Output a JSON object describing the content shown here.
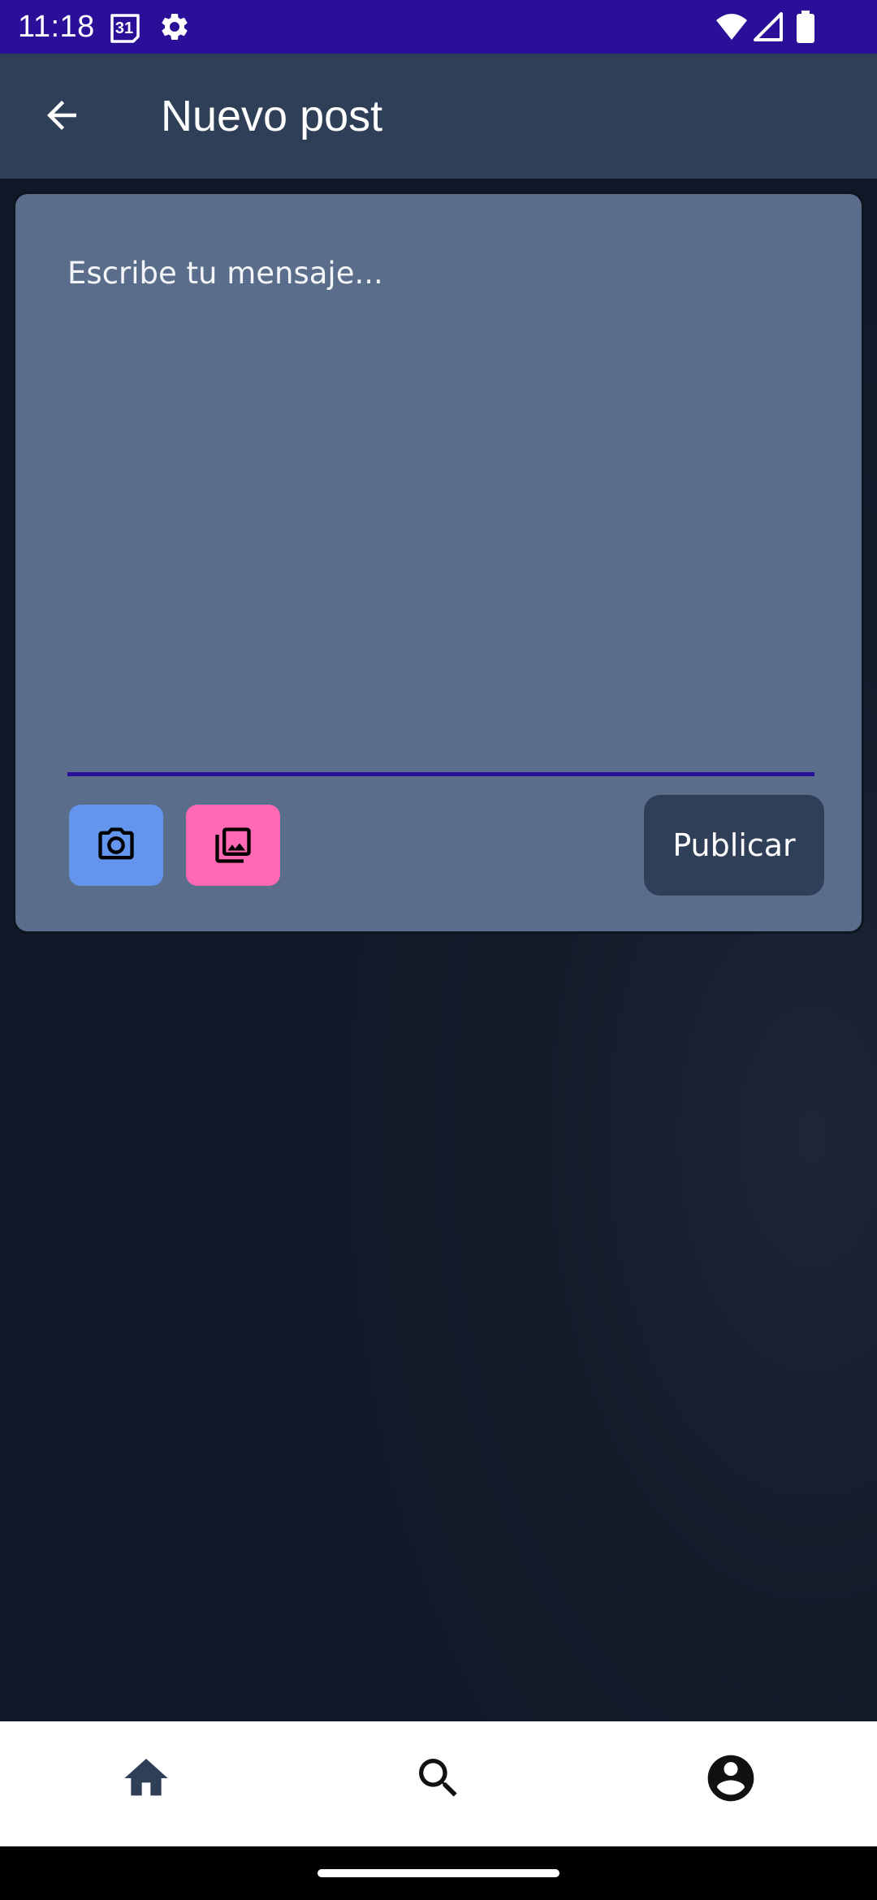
{
  "status_bar": {
    "time": "11:18",
    "calendar_badge": "31",
    "icons": [
      "calendar-icon",
      "settings-icon",
      "wifi-icon",
      "signal-icon",
      "battery-icon"
    ],
    "background_color": "#2a0f98"
  },
  "app_bar": {
    "back_icon": "arrow-back-icon",
    "title": "Nuevo post",
    "background_color": "#2f3f57"
  },
  "composer": {
    "message_placeholder": "Escribe tu mensaje...",
    "message_value": "",
    "underline_color": "#2a0f98",
    "card_color": "#5a6e8b",
    "camera_button": {
      "icon": "camera-icon",
      "color": "#6495ed"
    },
    "gallery_button": {
      "icon": "photo-library-icon",
      "color": "#ff69b4"
    },
    "publish_label": "Publicar"
  },
  "bottom_nav": {
    "items": [
      {
        "name": "home",
        "icon": "home-icon",
        "selected": true
      },
      {
        "name": "search",
        "icon": "search-icon",
        "selected": false
      },
      {
        "name": "profile",
        "icon": "account-circle-icon",
        "selected": false
      }
    ],
    "selected_color": "#2f3f57",
    "default_color": "#111111"
  }
}
